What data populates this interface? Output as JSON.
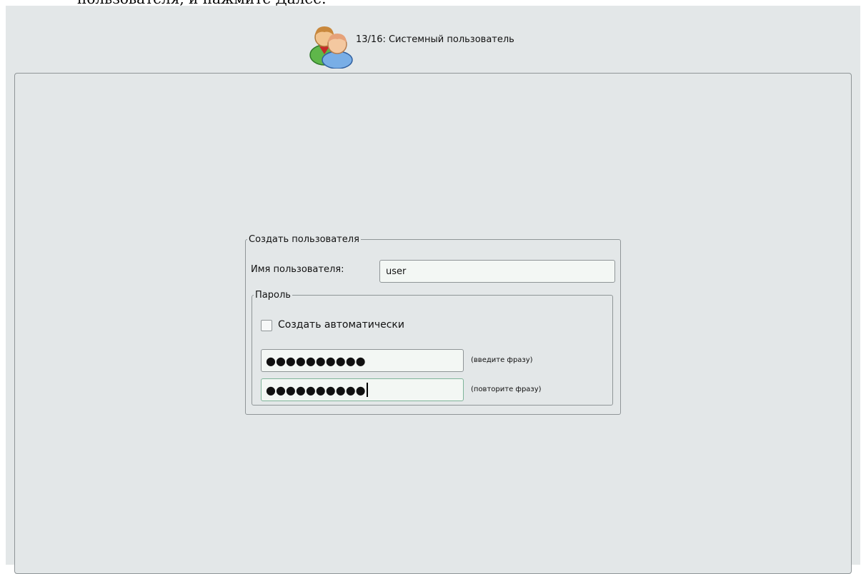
{
  "document": {
    "overflow_text": "пользователя, и нажмите Далее."
  },
  "header": {
    "step_title": "13/16: Системный пользователь",
    "icon": "users-icon"
  },
  "create_user": {
    "legend": "Создать пользователя",
    "username_label": "Имя пользователя:",
    "username_value": "user",
    "password": {
      "legend": "Пароль",
      "auto_label": "Создать автоматически",
      "auto_checked": false,
      "password_mask": "●●●●●●●●●●",
      "password_hint": "(введите фразу)",
      "confirm_mask": "●●●●●●●●●●",
      "confirm_hint": "(повторите фразу)"
    }
  },
  "colors": {
    "window_bg": "#e3e7e8",
    "border": "#8f9597",
    "input_bg": "#f3f7f4",
    "focus_border": "#7fb49a"
  }
}
